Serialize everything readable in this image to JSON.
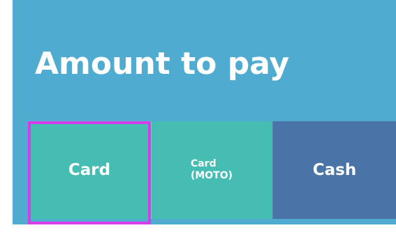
{
  "header": {
    "title": "Amount to pay"
  },
  "payment_methods": [
    {
      "id": "card",
      "label": "Card",
      "selected": true
    },
    {
      "id": "card-moto",
      "label": "Card\n(MOTO)",
      "selected": false
    },
    {
      "id": "cash",
      "label": "Cash",
      "selected": false
    }
  ],
  "colors": {
    "panel_background": "#4fabcf",
    "card_button": "#45bdb3",
    "cash_button": "#4a74a7",
    "selection_outline": "#d63ce8",
    "text": "#ffffff"
  }
}
